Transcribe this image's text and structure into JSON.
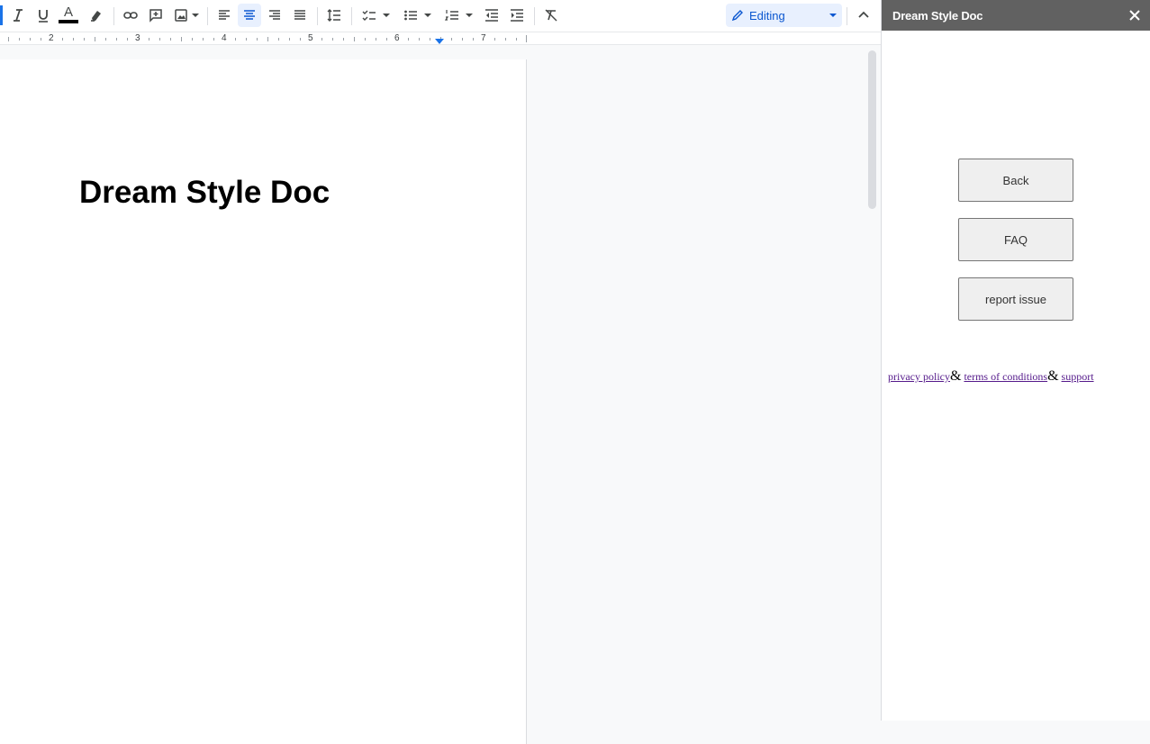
{
  "toolbar": {
    "buttons": [
      {
        "name": "italic-icon"
      },
      {
        "name": "underline-icon"
      },
      {
        "name": "text-color-icon",
        "color": "#000000"
      },
      {
        "name": "highlight-icon"
      },
      {
        "name": "insert-link-icon"
      },
      {
        "name": "add-comment-icon"
      },
      {
        "name": "insert-image-icon"
      },
      {
        "name": "align-left-icon"
      },
      {
        "name": "align-center-icon",
        "active": true
      },
      {
        "name": "align-right-icon"
      },
      {
        "name": "align-justify-icon"
      },
      {
        "name": "line-spacing-icon"
      },
      {
        "name": "checklist-icon"
      },
      {
        "name": "bulleted-list-icon"
      },
      {
        "name": "numbered-list-icon"
      },
      {
        "name": "decrease-indent-icon"
      },
      {
        "name": "increase-indent-icon"
      },
      {
        "name": "clear-formatting-icon"
      }
    ],
    "text_color_glyph": "A",
    "mode_label": "Editing",
    "accent_color": "#1a73e8"
  },
  "ruler": {
    "numbers": [
      "2",
      "3",
      "4",
      "5",
      "6",
      "7"
    ]
  },
  "document": {
    "title": "Dream Style Doc"
  },
  "panel": {
    "title": "Dream Style Doc",
    "header_color": "#616161",
    "buttons": {
      "back": "Back",
      "faq": "FAQ",
      "report": "report issue"
    },
    "links": {
      "privacy": "privacy policy",
      "terms": "terms of conditions",
      "support": "support",
      "separator": "&"
    }
  }
}
